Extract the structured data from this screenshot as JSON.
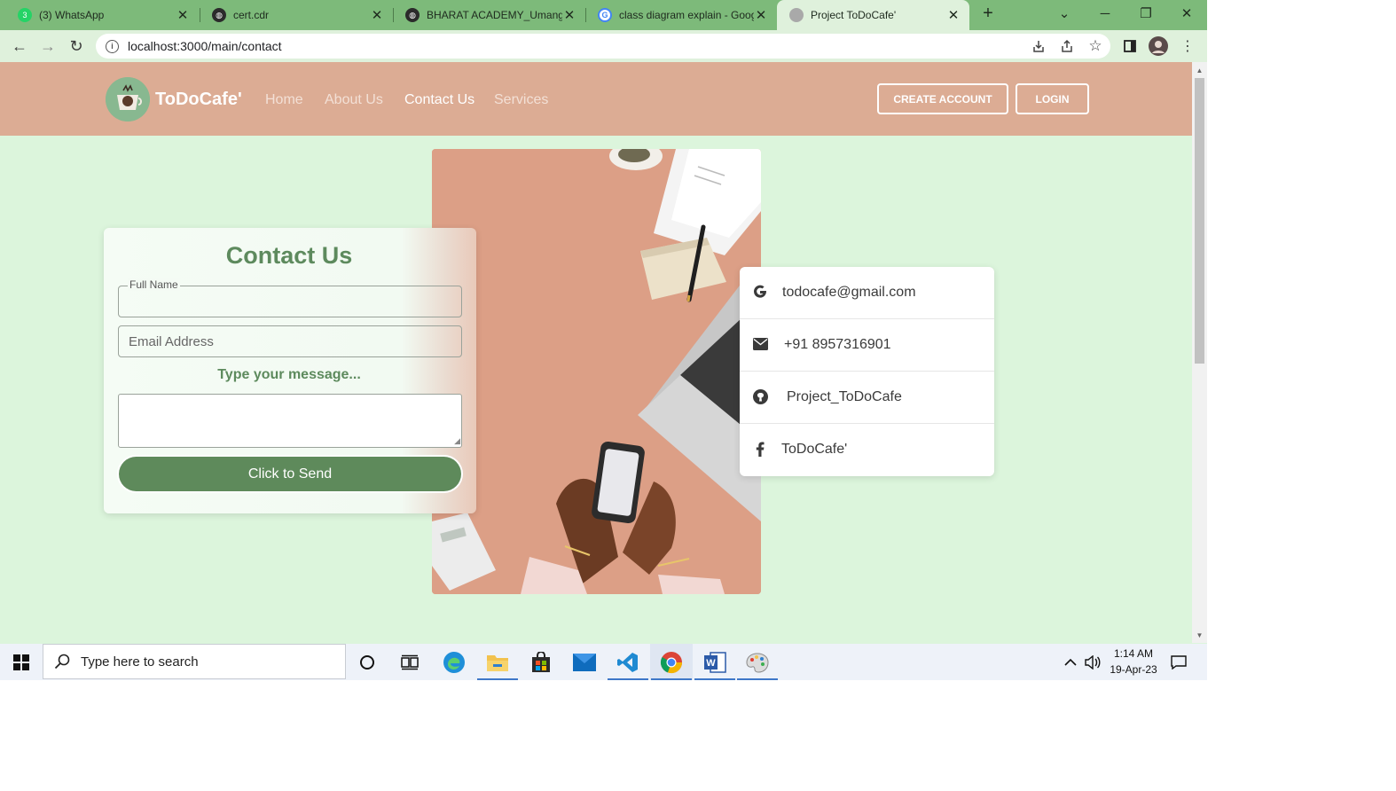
{
  "browser": {
    "tabs": [
      {
        "title": "(3) WhatsApp",
        "icon": "whatsapp-icon"
      },
      {
        "title": "cert.cdr",
        "icon": "globe-icon"
      },
      {
        "title": "BHARAT ACADEMY_Umang S",
        "icon": "globe-icon"
      },
      {
        "title": "class diagram explain - Goog",
        "icon": "google-icon"
      },
      {
        "title": "Project ToDoCafe'",
        "icon": "todocafe-icon",
        "active": true
      }
    ],
    "new_tab": "+",
    "url": "localhost:3000/main/contact"
  },
  "site": {
    "brand": "ToDoCafe'",
    "nav": [
      "Home",
      "About Us",
      "Contact Us",
      "Services"
    ],
    "active_nav": "Contact Us",
    "create_account": "CREATE ACCOUNT",
    "login": "LOGIN",
    "colors": {
      "header": "#dcac94",
      "page": "#dcf5dc",
      "accent": "#5e8a5b",
      "illustration": "#dc9f86"
    }
  },
  "contact_form": {
    "title": "Contact Us",
    "full_name_label": "Full Name",
    "email_placeholder": "Email Address",
    "message_label": "Type your message...",
    "send_button": "Click to Send"
  },
  "contact_info": [
    {
      "icon": "google-icon",
      "text": "todocafe@gmail.com"
    },
    {
      "icon": "envelope-icon",
      "text": "+91 8957316901"
    },
    {
      "icon": "github-icon",
      "text": "Project_ToDoCafe"
    },
    {
      "icon": "facebook-icon",
      "text": "ToDoCafe'"
    }
  ],
  "taskbar": {
    "search_placeholder": "Type here to search",
    "time": "1:14 AM",
    "date": "19-Apr-23"
  }
}
